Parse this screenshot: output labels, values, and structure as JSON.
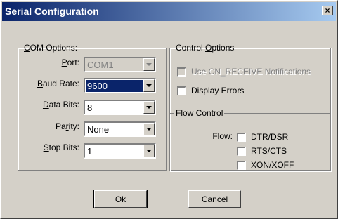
{
  "window": {
    "title": "Serial Configuration",
    "close_glyph": "×"
  },
  "com_options": {
    "legend_pre": "",
    "legend_accel": "C",
    "legend_post": "OM Options:",
    "fields": [
      {
        "label_pre": "",
        "label_accel": "P",
        "label_post": "ort:",
        "value": "COM1",
        "disabled": true
      },
      {
        "label_pre": "",
        "label_accel": "B",
        "label_post": "aud Rate:",
        "value": "9600",
        "selected": true
      },
      {
        "label_pre": "",
        "label_accel": "D",
        "label_post": "ata Bits:",
        "value": "8"
      },
      {
        "label_pre": "Pa",
        "label_accel": "r",
        "label_post": "ity:",
        "value": "None"
      },
      {
        "label_pre": "",
        "label_accel": "S",
        "label_post": "top Bits:",
        "value": "1"
      }
    ]
  },
  "control_options": {
    "legend_pre": "Control ",
    "legend_accel": "O",
    "legend_post": "ptions",
    "use_cn_receive": {
      "label": "Use CN_RECEIVE Notifications",
      "checked": false,
      "disabled": true
    },
    "display_errors": {
      "label": "Display Errors",
      "checked": false
    }
  },
  "flow_control": {
    "legend": "Flow Control",
    "flow_label_pre": "Fl",
    "flow_label_accel": "o",
    "flow_label_post": "w:",
    "options": [
      {
        "label": "DTR/DSR",
        "checked": false
      },
      {
        "label": "RTS/CTS",
        "checked": false
      },
      {
        "label": "XON/XOFF",
        "checked": false
      }
    ]
  },
  "buttons": {
    "ok": "Ok",
    "cancel": "Cancel"
  }
}
